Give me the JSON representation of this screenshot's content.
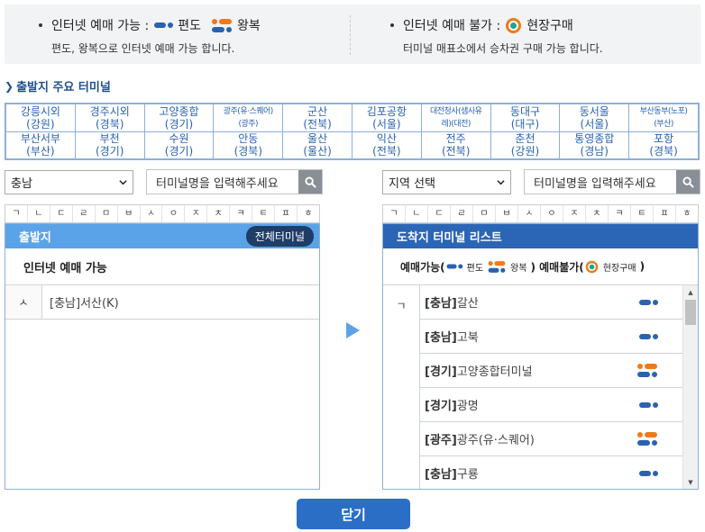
{
  "legend": {
    "online_title": "인터넷 예매 가능 :",
    "oneway_label": "편도",
    "round_label": "왕복",
    "online_desc": "편도, 왕복으로 인터넷 예매 가능 합니다.",
    "offline_title": "인터넷 예매 불가 :",
    "onsite_label": "현장구매",
    "offline_desc": "터미널 매표소에서 승차권 구매 가능 합니다."
  },
  "section_title": "출발지 주요 터미널",
  "terminals": [
    [
      {
        "name": "강릉시외",
        "region": "(강원)"
      },
      {
        "name": "경주시외",
        "region": "(경북)"
      },
      {
        "name": "고양종합",
        "region": "(경기)"
      },
      {
        "name": "광주(유·스퀘어)",
        "region": "(광주)",
        "small": true
      },
      {
        "name": "군산",
        "region": "(전북)"
      },
      {
        "name": "김포공항",
        "region": "(서울)"
      },
      {
        "name": "대전청사(샘사유",
        "region": "레)(대전)",
        "small": true
      },
      {
        "name": "동대구",
        "region": "(대구)"
      },
      {
        "name": "동서울",
        "region": "(서울)"
      },
      {
        "name": "부산동부(노포)",
        "region": "(부산)",
        "small": true
      }
    ],
    [
      {
        "name": "부산서부",
        "region": "(부산)"
      },
      {
        "name": "부천",
        "region": "(경기)"
      },
      {
        "name": "수원",
        "region": "(경기)"
      },
      {
        "name": "안동",
        "region": "(경북)"
      },
      {
        "name": "울산",
        "region": "(울산)"
      },
      {
        "name": "익산",
        "region": "(전북)"
      },
      {
        "name": "전주",
        "region": "(전북)"
      },
      {
        "name": "춘천",
        "region": "(강원)"
      },
      {
        "name": "통영종합",
        "region": "(경남)"
      },
      {
        "name": "포항",
        "region": "(경북)"
      }
    ]
  ],
  "left_select": "충남",
  "right_select": "지역 선택",
  "search_placeholder": "터미널명을 입력해주세요",
  "consonants": [
    "ㄱ",
    "ㄴ",
    "ㄷ",
    "ㄹ",
    "ㅁ",
    "ㅂ",
    "ㅅ",
    "ㅇ",
    "ㅈ",
    "ㅊ",
    "ㅋ",
    "ㅌ",
    "ㅍ",
    "ㅎ"
  ],
  "departure": {
    "title": "출발지",
    "all_button": "전체터미널",
    "subhead": "인터넷 예매 가능",
    "rows": [
      {
        "initial": "ㅅ",
        "name": "[충남]서산(K)"
      }
    ]
  },
  "arrival": {
    "title": "도착지 터미널 리스트",
    "legend_prefix": "예매가능(",
    "legend_oneway": "편도",
    "legend_round": "왕복",
    "legend_mid": ") 예매불가(",
    "legend_onsite": "현장구매",
    "legend_suffix": ")",
    "initial": "ㄱ",
    "rows": [
      {
        "region": "[충남]",
        "name": "갈산",
        "type": "oneway"
      },
      {
        "region": "[충남]",
        "name": "고북",
        "type": "oneway"
      },
      {
        "region": "[경기]",
        "name": "고양종합터미널",
        "type": "round"
      },
      {
        "region": "[경기]",
        "name": "광명",
        "type": "oneway"
      },
      {
        "region": "[광주]",
        "name": "광주(유·스퀘어)",
        "type": "round"
      },
      {
        "region": "[충남]",
        "name": "구룡",
        "type": "oneway"
      }
    ]
  },
  "close_button": "닫기",
  "colors": {
    "accent": "#2a6ec6",
    "oneway": "#2a62b0",
    "round": "#f07a1a",
    "onsite": "#1fa38a"
  }
}
